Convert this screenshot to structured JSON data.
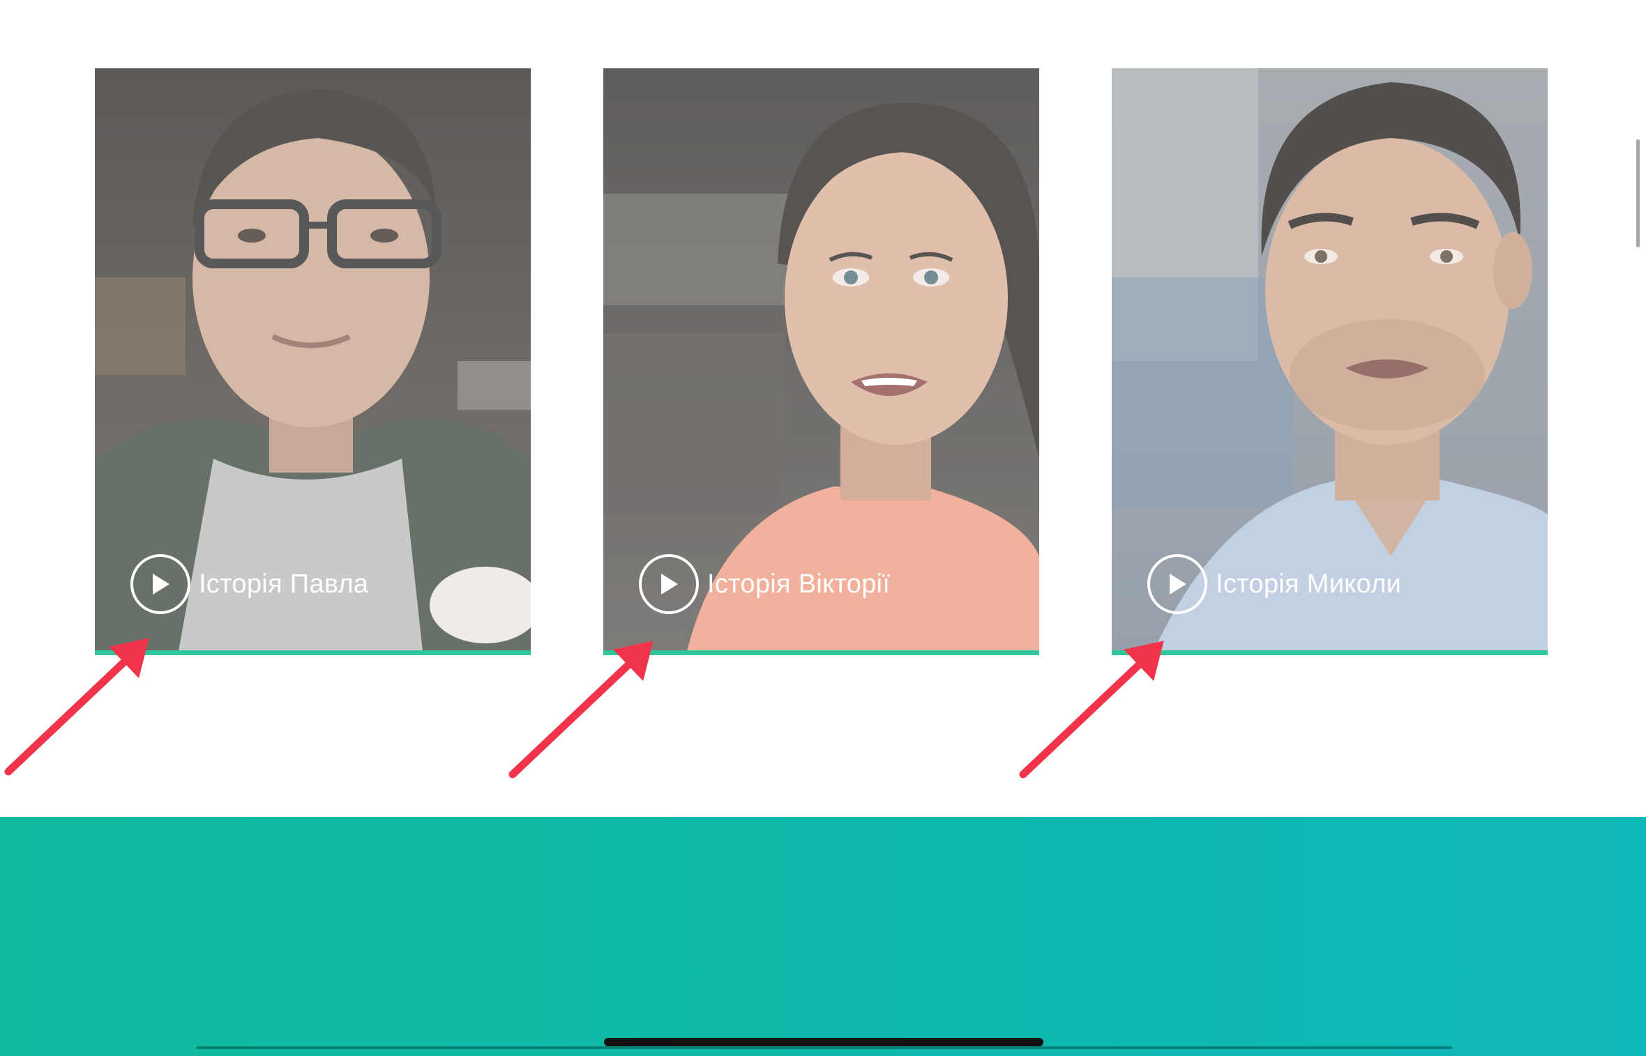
{
  "stories": [
    {
      "label": "Історія Павла",
      "play_icon": "play-icon",
      "photo": "man with glasses, green jacket",
      "colors": {
        "bg_top": "#3a3633",
        "bg_bottom": "#5e5750",
        "skin": "#c9a58c",
        "shirt": "#b9bcbb",
        "jacket": "#3f4a3f",
        "hair": "#2b2623"
      }
    },
    {
      "label": "Історія Вікторії",
      "play_icon": "play-icon",
      "photo": "woman with dark hair, coral shirt",
      "colors": {
        "bg_top": "#3a3735",
        "bg_bottom": "#5d5a57",
        "skin": "#d8ad95",
        "shirt": "#ee9c82",
        "jacket": "#ee9c82",
        "hair": "#2a2422"
      }
    },
    {
      "label": "Історія Миколи",
      "play_icon": "play-icon",
      "photo": "man with short dark hair, light blue shirt",
      "colors": {
        "bg_top": "#9aa3ad",
        "bg_bottom": "#7f8b98",
        "skin": "#d1a88f",
        "shirt": "#b3c2dc",
        "jacket": "#b3c2dc",
        "hair": "#231e1c"
      }
    }
  ],
  "accent_color": "#2fc79a",
  "arrow_color": "#f2344a",
  "band_color": "#0fba9d"
}
